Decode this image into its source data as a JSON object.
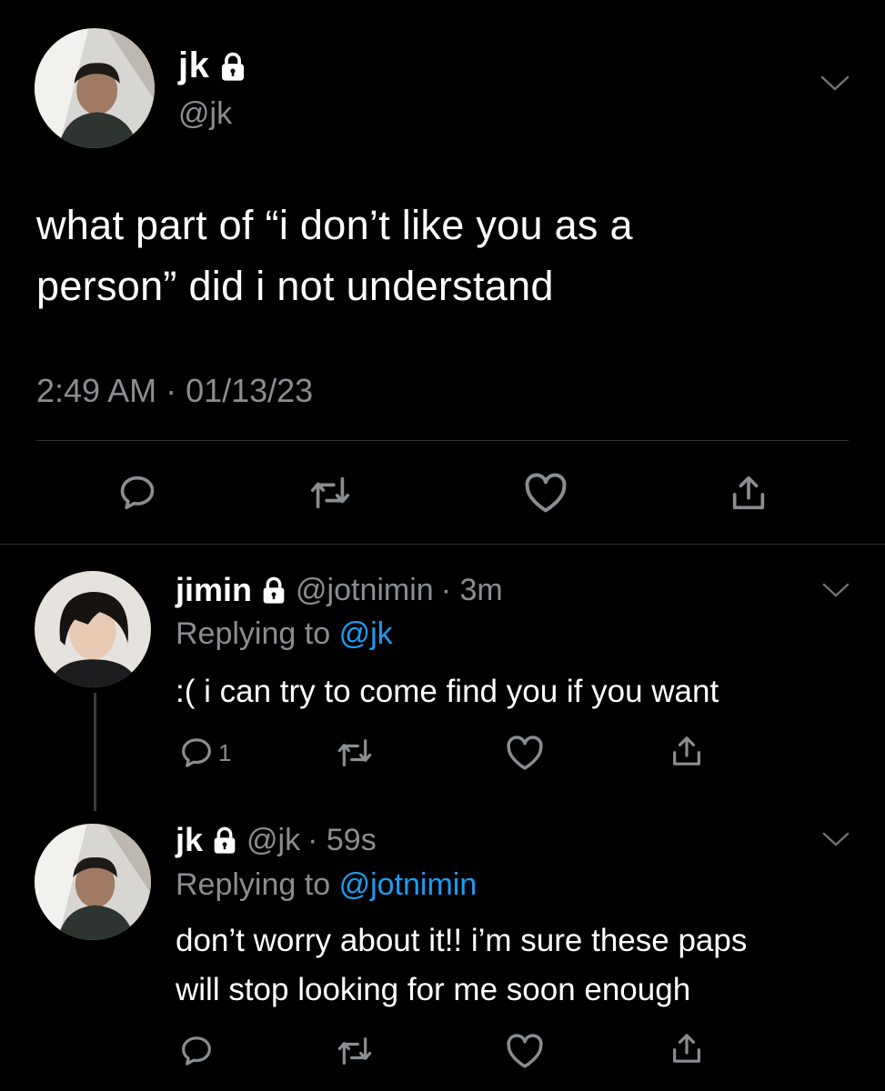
{
  "main_tweet": {
    "name": "jk",
    "handle": "@jk",
    "text_line1": "what part of “i don’t like you as a",
    "text_line2": "person” did i not understand",
    "meta": "2:49 AM · 01/13/23",
    "avatar_icon": "profile-photo",
    "lock_icon": "lock-icon"
  },
  "replies": [
    {
      "name": "jimin",
      "handle": "@jotnimin",
      "time": "· 3m",
      "replying_label": "Replying to",
      "replying_to": "@jk",
      "text_line1": ":( i can try to come find you if you want",
      "reply_count": "1"
    },
    {
      "name": "jk",
      "handle": "@jk",
      "time": "· 59s",
      "replying_label": "Replying to",
      "replying_to": "@jotnimin",
      "text_line1": "don’t worry about it!! i’m sure these paps",
      "text_line2": "will stop looking for me soon enough"
    }
  ],
  "colors": {
    "background": "#000000",
    "text": "#ffffff",
    "muted": "#8a8d91",
    "link": "#1d9bf0",
    "divider": "#2f3336"
  },
  "icons": [
    "chevron-down-icon",
    "lock-icon",
    "reply-icon",
    "retweet-icon",
    "like-icon",
    "share-icon"
  ]
}
